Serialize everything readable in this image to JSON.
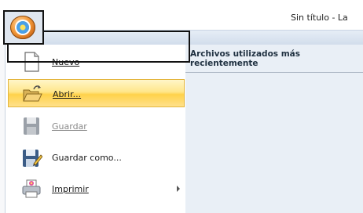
{
  "window": {
    "title": "Sin título - La"
  },
  "app_button": {
    "icon": "app-orb-flower-icon"
  },
  "recent": {
    "header": "Archivos utilizados más recientemente"
  },
  "menu": {
    "items": [
      {
        "label": "Nuevo",
        "icon": "new-document-icon",
        "enabled": true
      },
      {
        "label": "Abrir...",
        "icon": "open-folder-icon",
        "enabled": true,
        "selected": true
      },
      {
        "label": "Guardar",
        "icon": "save-icon",
        "enabled": false
      },
      {
        "label": "Guardar como...",
        "icon": "save-as-icon",
        "enabled": true
      },
      {
        "label": "Imprimir",
        "icon": "print-icon",
        "enabled": true,
        "has_submenu": true
      }
    ]
  },
  "colors": {
    "highlight": "#ffd24b",
    "ribbon": "#cfdbea",
    "recent_panel": "#e9eff6"
  }
}
